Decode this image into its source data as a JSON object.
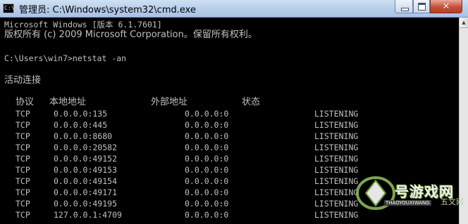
{
  "window": {
    "icon_label": "C:\\",
    "title": "管理员: C:\\Windows\\system32\\cmd.exe",
    "close_glyph": "✕"
  },
  "console": {
    "header_line1": "Microsoft Windows [版本 6.1.7601]",
    "header_line2": "版权所有 (c) 2009 Microsoft Corporation。保留所有权利。",
    "prompt": "C:\\Users\\win7>netstat -an",
    "section_title": "活动连接",
    "columns": [
      "协议",
      "本地地址",
      "外部地址",
      "状态"
    ],
    "rows": [
      {
        "proto": "TCP",
        "local": "0.0.0.0:135",
        "foreign": "0.0.0.0:0",
        "state": "LISTENING"
      },
      {
        "proto": "TCP",
        "local": "0.0.0.0:445",
        "foreign": "0.0.0.0:0",
        "state": "LISTENING"
      },
      {
        "proto": "TCP",
        "local": "0.0.0.0:8680",
        "foreign": "0.0.0.0:0",
        "state": "LISTENING"
      },
      {
        "proto": "TCP",
        "local": "0.0.0.0:20582",
        "foreign": "0.0.0.0:0",
        "state": "LISTENING"
      },
      {
        "proto": "TCP",
        "local": "0.0.0.0:49152",
        "foreign": "0.0.0.0:0",
        "state": "LISTENING"
      },
      {
        "proto": "TCP",
        "local": "0.0.0.0:49153",
        "foreign": "0.0.0.0:0",
        "state": "LISTENING"
      },
      {
        "proto": "TCP",
        "local": "0.0.0.0:49154",
        "foreign": "0.0.0.0:0",
        "state": "LISTENING"
      },
      {
        "proto": "TCP",
        "local": "0.0.0.0:49171",
        "foreign": "0.0.0.0:0",
        "state": "LISTENING"
      },
      {
        "proto": "TCP",
        "local": "0.0.0.0:49195",
        "foreign": "0.0.0.0:0",
        "state": "LISTENING"
      },
      {
        "proto": "TCP",
        "local": "127.0.0.1:4709",
        "foreign": "0.0.0.0:0",
        "state": "LISTENING"
      }
    ]
  },
  "scrollbar": {
    "up_glyph": "▲"
  },
  "watermark": {
    "brand": "号游戏网",
    "sub": "THAOYOUXIWANG",
    "small": "五文网"
  },
  "colors": {
    "console_bg": "#000000",
    "console_text": "#c0c0c0",
    "titlebar": "#b6cde9",
    "close_button": "#c8503a"
  },
  "icons": [
    "cmd-app-icon",
    "minimize-icon",
    "maximize-icon",
    "close-icon",
    "scroll-up-arrow-icon",
    "watermark-logo"
  ]
}
